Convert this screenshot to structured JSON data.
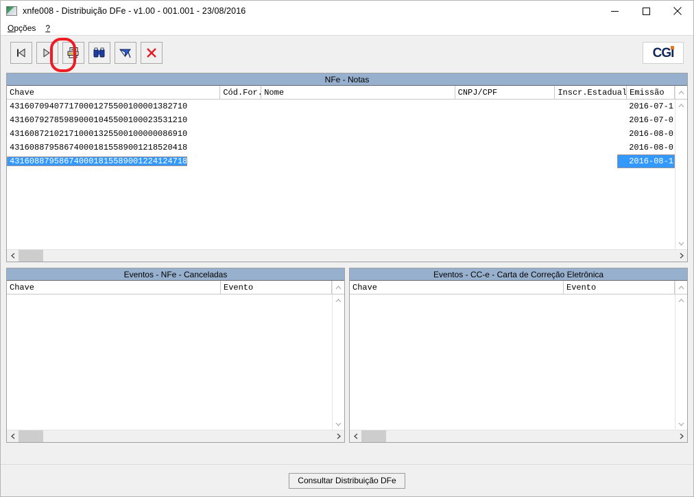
{
  "window": {
    "title": "xnfe008 - Distribuição DFe - v1.00 - 001.001 - 23/08/2016",
    "icon": "app-window-icon",
    "minimize_label": "Minimizar",
    "maximize_label": "Maximizar",
    "close_label": "Fechar"
  },
  "menubar": {
    "items": [
      {
        "label": "Opções",
        "mnemonic": "O",
        "rest": "pções"
      },
      {
        "label": "?",
        "mnemonic": "?",
        "rest": ""
      }
    ]
  },
  "toolbar": {
    "buttons": [
      {
        "name": "first-record-button",
        "icon": "first-record-icon",
        "tooltip": "Primeiro"
      },
      {
        "name": "last-record-button",
        "icon": "last-record-icon",
        "tooltip": "Último"
      },
      {
        "name": "print-button",
        "icon": "printer-icon",
        "tooltip": "Imprimir",
        "highlighted": true
      },
      {
        "name": "find-button",
        "icon": "binoculars-icon",
        "tooltip": "Localizar"
      },
      {
        "name": "filter-button",
        "icon": "filter-flag-icon",
        "tooltip": "Filtrar"
      },
      {
        "name": "close-button",
        "icon": "red-x-icon",
        "tooltip": "Fechar"
      }
    ],
    "logo": {
      "text": "CGI",
      "accent_color": "#e8761a",
      "text_color": "#12265a"
    }
  },
  "annotation": {
    "type": "red-oval-highlight",
    "target": "print-button",
    "color": "#ee1c22"
  },
  "panels": {
    "notas": {
      "title": "NFe - Notas",
      "columns": [
        "Chave",
        "Cód.For.",
        "Nome",
        "CNPJ/CPF",
        "Inscr.Estadual",
        "Emissão"
      ],
      "rows": [
        {
          "chave": "43160709407717000127550010000138271 0",
          "emissao": "2016-07-1",
          "selected": false
        },
        {
          "chave": "43160792785989000104550010002353121 0",
          "emissao": "2016-07-0",
          "selected": false
        },
        {
          "chave": "43160872102171000132550010000008691 0",
          "emissao": "2016-08-0",
          "selected": false
        },
        {
          "chave": "43160887958674000181558900121852041 8",
          "emissao": "2016-08-0",
          "selected": false
        },
        {
          "chave": "43160887958674000181558900122412471 8",
          "emissao": "2016-08-1",
          "selected": true
        }
      ]
    },
    "canceladas": {
      "title": "Eventos - NFe - Canceladas",
      "columns": [
        "Chave",
        "Evento"
      ],
      "rows": []
    },
    "cce": {
      "title": "Eventos - CC-e - Carta de Correção Eletrônica",
      "columns": [
        "Chave",
        "Evento"
      ],
      "rows": []
    }
  },
  "footer": {
    "consult_label": "Consultar Distribuição DFe"
  }
}
